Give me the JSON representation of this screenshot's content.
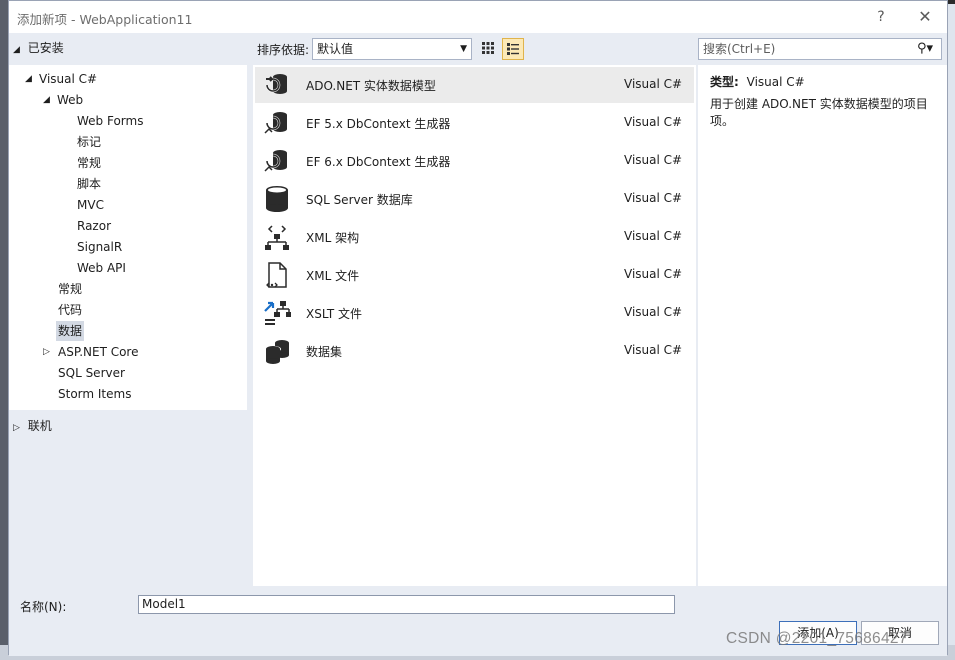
{
  "window": {
    "title": "添加新项 - WebApplication11",
    "help": "?",
    "close": "✕"
  },
  "left": {
    "header": "已安装",
    "tree": [
      {
        "label": "Visual C#",
        "expander": "◢"
      },
      {
        "label": "Web",
        "expander": "◢"
      },
      {
        "label": "Web Forms"
      },
      {
        "label": "标记"
      },
      {
        "label": "常规"
      },
      {
        "label": "脚本"
      },
      {
        "label": "MVC"
      },
      {
        "label": "Razor"
      },
      {
        "label": "SignalR"
      },
      {
        "label": "Web API"
      },
      {
        "label": "常规"
      },
      {
        "label": "代码"
      },
      {
        "label": "数据",
        "selected": true
      },
      {
        "label": "ASP.NET Core",
        "expander": "▷"
      },
      {
        "label": "SQL Server"
      },
      {
        "label": "Storm Items"
      }
    ],
    "online": "联机",
    "online_expander": "▷"
  },
  "toolbar": {
    "sort_label": "排序依据:",
    "sort_value": "默认值",
    "search_placeholder": "搜索(Ctrl+E)"
  },
  "items": [
    {
      "name": "ADO.NET 实体数据模型",
      "lang": "Visual C#",
      "icon": "entity-model-icon",
      "selected": true
    },
    {
      "name": "EF 5.x DbContext 生成器",
      "lang": "Visual C#",
      "icon": "ef-generator-icon"
    },
    {
      "name": "EF 6.x DbContext 生成器",
      "lang": "Visual C#",
      "icon": "ef-generator-icon"
    },
    {
      "name": "SQL Server 数据库",
      "lang": "Visual C#",
      "icon": "database-icon"
    },
    {
      "name": "XML 架构",
      "lang": "Visual C#",
      "icon": "xml-schema-icon"
    },
    {
      "name": "XML 文件",
      "lang": "Visual C#",
      "icon": "xml-file-icon"
    },
    {
      "name": "XSLT 文件",
      "lang": "Visual C#",
      "icon": "xslt-file-icon"
    },
    {
      "name": "数据集",
      "lang": "Visual C#",
      "icon": "dataset-icon"
    }
  ],
  "detail": {
    "type_label": "类型:",
    "type_value": "Visual C#",
    "description": "用于创建 ADO.NET 实体数据模型的项目项。"
  },
  "bottom": {
    "name_label": "名称(N):",
    "name_value": "Model1",
    "add_button": "添加(A)",
    "cancel_button": "取消"
  },
  "watermark": "CSDN @2201_75686427"
}
